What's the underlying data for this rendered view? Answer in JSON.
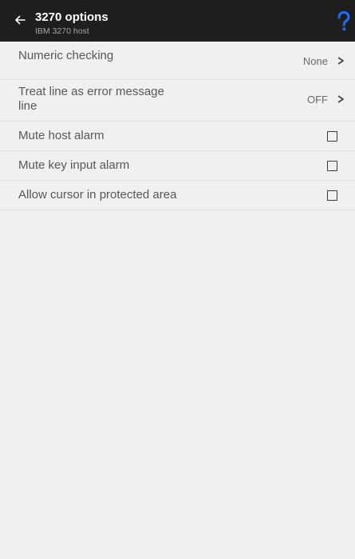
{
  "header": {
    "title": "3270 options",
    "subtitle": "IBM 3270 host",
    "back_icon": "back-arrow-icon",
    "help_icon": "help-icon",
    "help_color": "#1e6bff"
  },
  "settings": {
    "numeric_checking": {
      "label": "Numeric checking",
      "value": "None"
    },
    "error_line": {
      "label": "Treat line as error message line",
      "value": "OFF"
    },
    "mute_host_alarm": {
      "label": "Mute host alarm",
      "checked": false
    },
    "mute_key_alarm": {
      "label": "Mute key input alarm",
      "checked": false
    },
    "cursor_protected": {
      "label": "Allow cursor in protected area",
      "checked": false
    }
  }
}
